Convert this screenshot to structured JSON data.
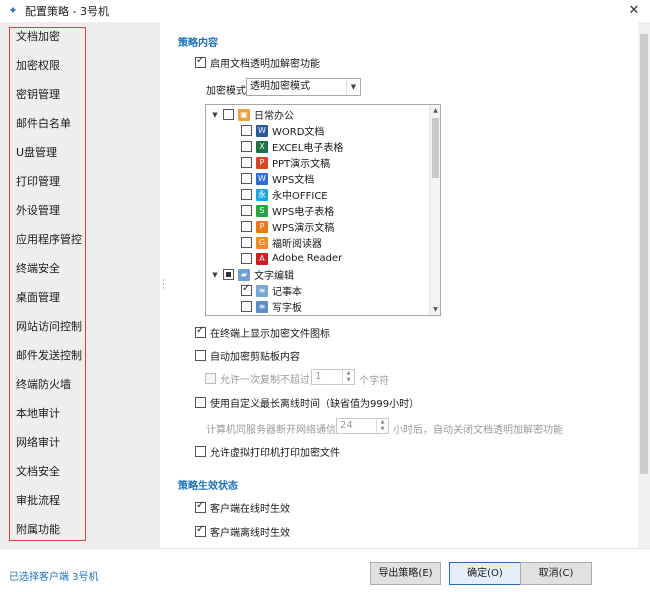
{
  "window": {
    "title": "配置策略 - 3号机",
    "app_icon": "policy-app-icon",
    "close_glyph": "✕"
  },
  "sidebar": {
    "items": [
      {
        "label": "文档加密",
        "active": true
      },
      {
        "label": "加密权限"
      },
      {
        "label": "密钥管理"
      },
      {
        "label": "邮件白名单"
      },
      {
        "label": "U盘管理"
      },
      {
        "label": "打印管理"
      },
      {
        "label": "外设管理"
      },
      {
        "label": "应用程序管控"
      },
      {
        "label": "终端安全"
      },
      {
        "label": "桌面管理"
      },
      {
        "label": "网站访问控制"
      },
      {
        "label": "邮件发送控制"
      },
      {
        "label": "终端防火墙"
      },
      {
        "label": "本地审计"
      },
      {
        "label": "网络审计"
      },
      {
        "label": "文档安全"
      },
      {
        "label": "审批流程"
      },
      {
        "label": "附属功能"
      }
    ]
  },
  "content": {
    "section1_title": "策略内容",
    "enable_label": "启用文档透明加解密功能",
    "enable_checked": true,
    "mode_label": "加密模式",
    "mode_value": "透明加密模式",
    "tree": {
      "group1": {
        "label": "日常办公",
        "state": "unchecked"
      },
      "group1_items": [
        {
          "label": "WORD文档",
          "icon": "word-icon",
          "color": "#2b5797",
          "glyph": "W"
        },
        {
          "label": "EXCEL电子表格",
          "icon": "excel-icon",
          "color": "#1e7145",
          "glyph": "X"
        },
        {
          "label": "PPT演示文稿",
          "icon": "ppt-icon",
          "color": "#d24726",
          "glyph": "P"
        },
        {
          "label": "WPS文档",
          "icon": "wps-writer-icon",
          "color": "#2f6bd3",
          "glyph": "W"
        },
        {
          "label": "永中OFFICE",
          "icon": "yozo-office-icon",
          "color": "#1aa7e0",
          "glyph": "永"
        },
        {
          "label": "WPS电子表格",
          "icon": "wps-sheet-icon",
          "color": "#2ba245",
          "glyph": "S"
        },
        {
          "label": "WPS演示文稿",
          "icon": "wps-presentation-icon",
          "color": "#e87a1e",
          "glyph": "P"
        },
        {
          "label": "福昕阅读器",
          "icon": "foxit-reader-icon",
          "color": "#f08a24",
          "glyph": "G"
        },
        {
          "label": "Adobe Reader",
          "icon": "adobe-reader-icon",
          "color": "#cc1f1f",
          "glyph": "A"
        }
      ],
      "group2": {
        "label": "文字编辑",
        "state": "partial"
      },
      "group2_items": [
        {
          "label": "记事本",
          "icon": "notepad-icon",
          "color": "#7aa7d6",
          "glyph": "≡",
          "checked": true
        },
        {
          "label": "写字板",
          "icon": "wordpad-icon",
          "color": "#5b8fc7",
          "glyph": "≡",
          "checked": false
        }
      ]
    },
    "show_icon_label": "在终端上显示加密文件图标",
    "show_icon_checked": true,
    "auto_clipboard_label": "自动加密剪贴板内容",
    "allow_copy_prefix": "允许一次复制不超过",
    "allow_copy_value": "1",
    "allow_copy_suffix": "个字符",
    "offline_label": "使用自定义最长离线时间（缺省值为999小时）",
    "offline_prefix": "计算机同服务器断开网络通信",
    "offline_value": "24",
    "offline_suffix": "小时后，自动关闭文档透明加解密功能",
    "virtual_printer_label": "允许虚拟打印机打印加密文件",
    "section2_title": "策略生效状态",
    "online_label": "客户端在线时生效",
    "online_checked": true,
    "offline_effect_label": "客户端离线时生效",
    "offline_effect_checked": true
  },
  "footer": {
    "status": "已选择客户端 3号机",
    "export_label": "导出策略(E)",
    "ok_label": "确定(O)",
    "cancel_label": "取消(C)"
  }
}
